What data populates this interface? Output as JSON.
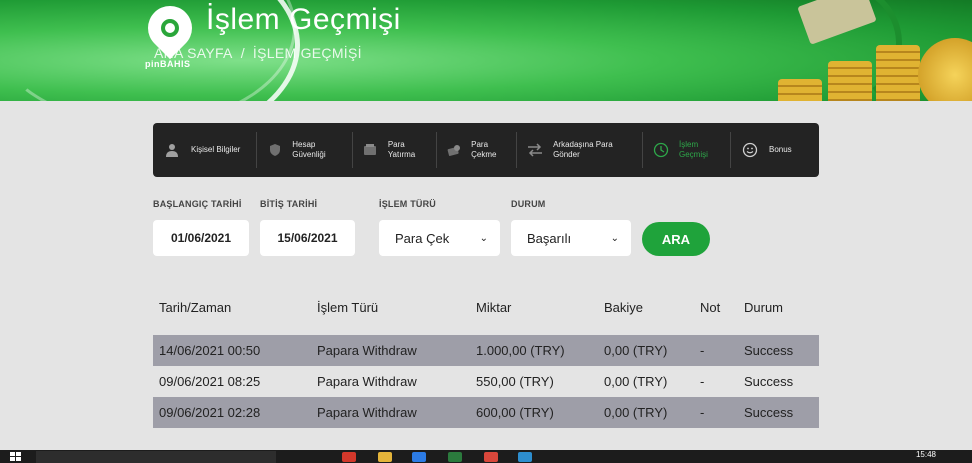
{
  "header": {
    "title": "İşlem Geçmişi",
    "breadcrumb_home": "ANA SAYFA",
    "breadcrumb_sep": "/",
    "breadcrumb_current": "İŞLEM GEÇMİŞİ",
    "logo_text": "pinBAHIS"
  },
  "tabs": [
    {
      "label": "Kişisel Bilgiler",
      "icon": "user-icon"
    },
    {
      "label": "Hesap Güvenliği",
      "icon": "shield-icon"
    },
    {
      "label": "Para Yatırma",
      "icon": "wallet-icon"
    },
    {
      "label": "Para Çekme",
      "icon": "cash-icon"
    },
    {
      "label": "Arkadaşına Para Gönder",
      "icon": "transfer-icon"
    },
    {
      "label": "İşlem Geçmişi",
      "icon": "history-icon",
      "active": true
    },
    {
      "label": "Bonus",
      "icon": "smile-icon"
    }
  ],
  "filters": {
    "start_label": "BAŞLANGIÇ TARİHİ",
    "start_value": "01/06/2021",
    "end_label": "BİTİŞ TARİHİ",
    "end_value": "15/06/2021",
    "type_label": "İŞLEM TÜRÜ",
    "type_value": "Para Çek",
    "status_label": "DURUM",
    "status_value": "Başarılı",
    "search_button": "ARA"
  },
  "table": {
    "headers": [
      "Tarih/Zaman",
      "İşlem Türü",
      "Miktar",
      "Bakiye",
      "Not",
      "Durum"
    ],
    "rows": [
      [
        "14/06/2021 00:50",
        "Papara Withdraw",
        "1.000,00 (TRY)",
        "0,00 (TRY)",
        "-",
        "Success"
      ],
      [
        "09/06/2021 08:25",
        "Papara Withdraw",
        "550,00 (TRY)",
        "0,00 (TRY)",
        "-",
        "Success"
      ],
      [
        "09/06/2021 02:28",
        "Papara Withdraw",
        "600,00 (TRY)",
        "0,00 (TRY)",
        "-",
        "Success"
      ]
    ]
  },
  "taskbar": {
    "clock": "15:48"
  },
  "colors": {
    "accent": "#1fa33b",
    "nav_bg": "#232323",
    "row_dark": "#9e9ea8"
  }
}
